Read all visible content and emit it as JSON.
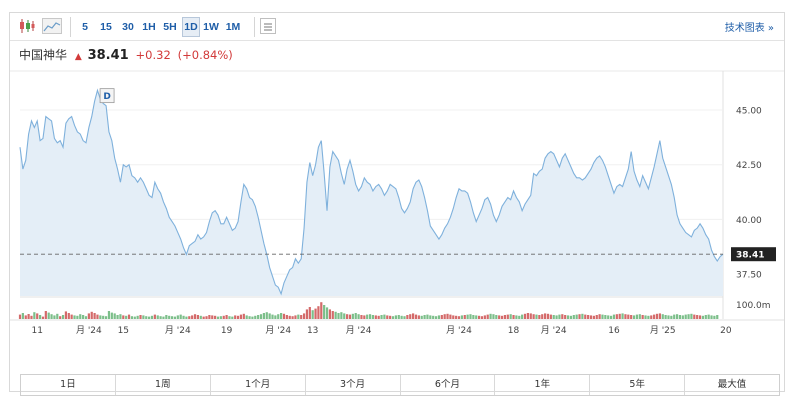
{
  "toolbar": {
    "icons": [
      {
        "name": "candlestick-chart-icon"
      },
      {
        "name": "mountain-chart-icon"
      }
    ],
    "timeframes": [
      {
        "label": "5",
        "active": false
      },
      {
        "label": "15",
        "active": false
      },
      {
        "label": "30",
        "active": false
      },
      {
        "label": "1H",
        "active": false
      },
      {
        "label": "5H",
        "active": false
      },
      {
        "label": "1D",
        "active": true
      },
      {
        "label": "1W",
        "active": false
      },
      {
        "label": "1M",
        "active": false
      }
    ],
    "settings_icon": "chart-settings-icon",
    "tech_chart_link": "技术图表 »"
  },
  "quote": {
    "name": "中国神华",
    "price": "38.41",
    "change": "+0.32",
    "change_pct": "(+0.84%)",
    "direction_icon": "up-arrow-icon",
    "up_color": "#d23a3a"
  },
  "chart_data": {
    "type": "area",
    "y_ticks": [
      "45.00",
      "42.50",
      "40.00",
      "37.50"
    ],
    "y_tick_values": [
      45.0,
      42.5,
      40.0,
      37.5
    ],
    "ylim": [
      36.5,
      46.6
    ],
    "current_price_label": "38.41",
    "current_price": 38.41,
    "volume_label": "100.0m",
    "dividend_marker": {
      "label": "D",
      "index": 30
    },
    "x_tick_labels": [
      "11",
      "月 '24",
      "15",
      "月 '24",
      "19",
      "月 '24",
      "13",
      "月 '24",
      "月 '24",
      "18",
      "月 '24",
      "16",
      "月 '25",
      "20"
    ],
    "x_tick_index": [
      6,
      24,
      36,
      55,
      72,
      90,
      102,
      118,
      153,
      172,
      186,
      207,
      224,
      246
    ],
    "series": [
      {
        "values": [
          43.3,
          42.3,
          42.7,
          43.9,
          44.5,
          44.2,
          44.5,
          43.6,
          43.7,
          44.7,
          44.6,
          44.5,
          43.7,
          43.5,
          43.6,
          43.3,
          44.4,
          44.6,
          44.7,
          44.3,
          44.0,
          43.9,
          43.6,
          43.5,
          44.2,
          44.7,
          45.4,
          45.9,
          45.5,
          45.3,
          45.2,
          44.0,
          43.6,
          42.8,
          42.3,
          41.7,
          42.5,
          42.4,
          42.5,
          42.0,
          41.9,
          41.7,
          41.9,
          41.7,
          41.4,
          41.1,
          41.0,
          41.7,
          41.4,
          41.2,
          40.8,
          40.5,
          40.1,
          39.9,
          39.7,
          39.4,
          39.1,
          38.7,
          38.4,
          38.8,
          38.9,
          39.0,
          39.3,
          39.1,
          39.2,
          39.4,
          39.9,
          40.3,
          40.4,
          40.2,
          39.8,
          39.8,
          40.1,
          39.8,
          39.5,
          39.6,
          39.9,
          40.8,
          41.6,
          41.4,
          41.0,
          40.9,
          40.6,
          40.1,
          39.5,
          38.9,
          38.4,
          37.8,
          37.4,
          37.0,
          36.9,
          36.6,
          37.1,
          37.4,
          37.7,
          37.8,
          38.2,
          38.0,
          38.2,
          39.6,
          41.7,
          42.6,
          42.0,
          42.5,
          43.3,
          43.6,
          42.1,
          40.4,
          42.4,
          43.1,
          42.9,
          42.7,
          42.1,
          41.6,
          42.3,
          42.7,
          42.2,
          41.6,
          41.3,
          41.5,
          41.9,
          41.7,
          41.6,
          41.3,
          41.5,
          41.6,
          41.4,
          41.1,
          41.3,
          41.6,
          41.5,
          41.4,
          41.0,
          40.5,
          40.3,
          40.5,
          40.8,
          41.4,
          41.7,
          41.8,
          41.5,
          41.0,
          40.4,
          39.7,
          39.5,
          39.3,
          39.1,
          39.3,
          39.6,
          39.8,
          40.1,
          40.5,
          41.0,
          41.4,
          41.3,
          41.3,
          41.2,
          40.8,
          40.3,
          39.9,
          40.2,
          40.5,
          40.9,
          41.0,
          40.7,
          40.2,
          39.9,
          40.2,
          40.6,
          40.8,
          41.0,
          40.9,
          41.3,
          41.0,
          40.8,
          40.4,
          40.7,
          40.9,
          41.1,
          42.1,
          42.0,
          42.2,
          42.3,
          42.8,
          43.0,
          43.1,
          43.0,
          42.7,
          42.4,
          42.8,
          43.0,
          42.7,
          42.4,
          42.1,
          41.9,
          41.9,
          41.8,
          41.9,
          42.1,
          42.3,
          42.6,
          42.8,
          42.9,
          42.7,
          42.4,
          42.0,
          41.6,
          41.2,
          41.5,
          41.6,
          41.5,
          41.9,
          42.3,
          43.1,
          42.2,
          41.8,
          41.5,
          42.0,
          41.7,
          41.4,
          41.9,
          42.4,
          43.0,
          43.6,
          42.8,
          42.4,
          42.0,
          41.6,
          41.0,
          40.2,
          39.8,
          39.6,
          39.4,
          39.3,
          39.2,
          39.5,
          39.6,
          39.8,
          39.6,
          39.3,
          39.1,
          38.6,
          38.3,
          38.1,
          38.3,
          38.41
        ],
        "color": "#7fb1dc"
      }
    ],
    "volumes": [
      22,
      30,
      18,
      25,
      16,
      34,
      28,
      20,
      12,
      40,
      32,
      24,
      18,
      26,
      14,
      20,
      38,
      30,
      22,
      18,
      16,
      24,
      20,
      14,
      28,
      36,
      30,
      22,
      18,
      16,
      14,
      40,
      32,
      28,
      20,
      24,
      18,
      16,
      22,
      14,
      12,
      16,
      20,
      18,
      14,
      12,
      16,
      22,
      18,
      14,
      12,
      20,
      16,
      14,
      12,
      18,
      22,
      16,
      12,
      14,
      18,
      24,
      20,
      16,
      12,
      14,
      20,
      18,
      16,
      12,
      14,
      16,
      20,
      14,
      12,
      18,
      16,
      22,
      26,
      18,
      14,
      12,
      16,
      20,
      24,
      30,
      34,
      28,
      22,
      18,
      24,
      30,
      26,
      20,
      16,
      14,
      18,
      22,
      20,
      28,
      48,
      60,
      44,
      52,
      64,
      84,
      70,
      58,
      48,
      40,
      36,
      30,
      34,
      28,
      24,
      22,
      26,
      30,
      24,
      20,
      18,
      22,
      24,
      20,
      18,
      16,
      20,
      22,
      18,
      16,
      14,
      18,
      20,
      16,
      14,
      20,
      24,
      28,
      22,
      18,
      16,
      20,
      22,
      18,
      16,
      14,
      18,
      20,
      24,
      26,
      22,
      18,
      16,
      14,
      18,
      20,
      22,
      24,
      20,
      18,
      16,
      14,
      18,
      22,
      26,
      24,
      20,
      18,
      16,
      20,
      22,
      24,
      20,
      18,
      16,
      22,
      26,
      30,
      28,
      24,
      22,
      20,
      24,
      28,
      26,
      22,
      20,
      18,
      22,
      24,
      20,
      18,
      16,
      20,
      22,
      24,
      26,
      22,
      20,
      18,
      16,
      20,
      24,
      22,
      20,
      18,
      16,
      22,
      24,
      26,
      28,
      24,
      22,
      20,
      18,
      22,
      24,
      20,
      18,
      16,
      18,
      22,
      26,
      28,
      24,
      20,
      18,
      16,
      22,
      24,
      20,
      18,
      22,
      24,
      26,
      22,
      20,
      18,
      16,
      20,
      22,
      18,
      16,
      20
    ]
  },
  "range_buttons": [
    "1日",
    "1周",
    "1个月",
    "3个月",
    "6个月",
    "1年",
    "5年",
    "最大值"
  ]
}
